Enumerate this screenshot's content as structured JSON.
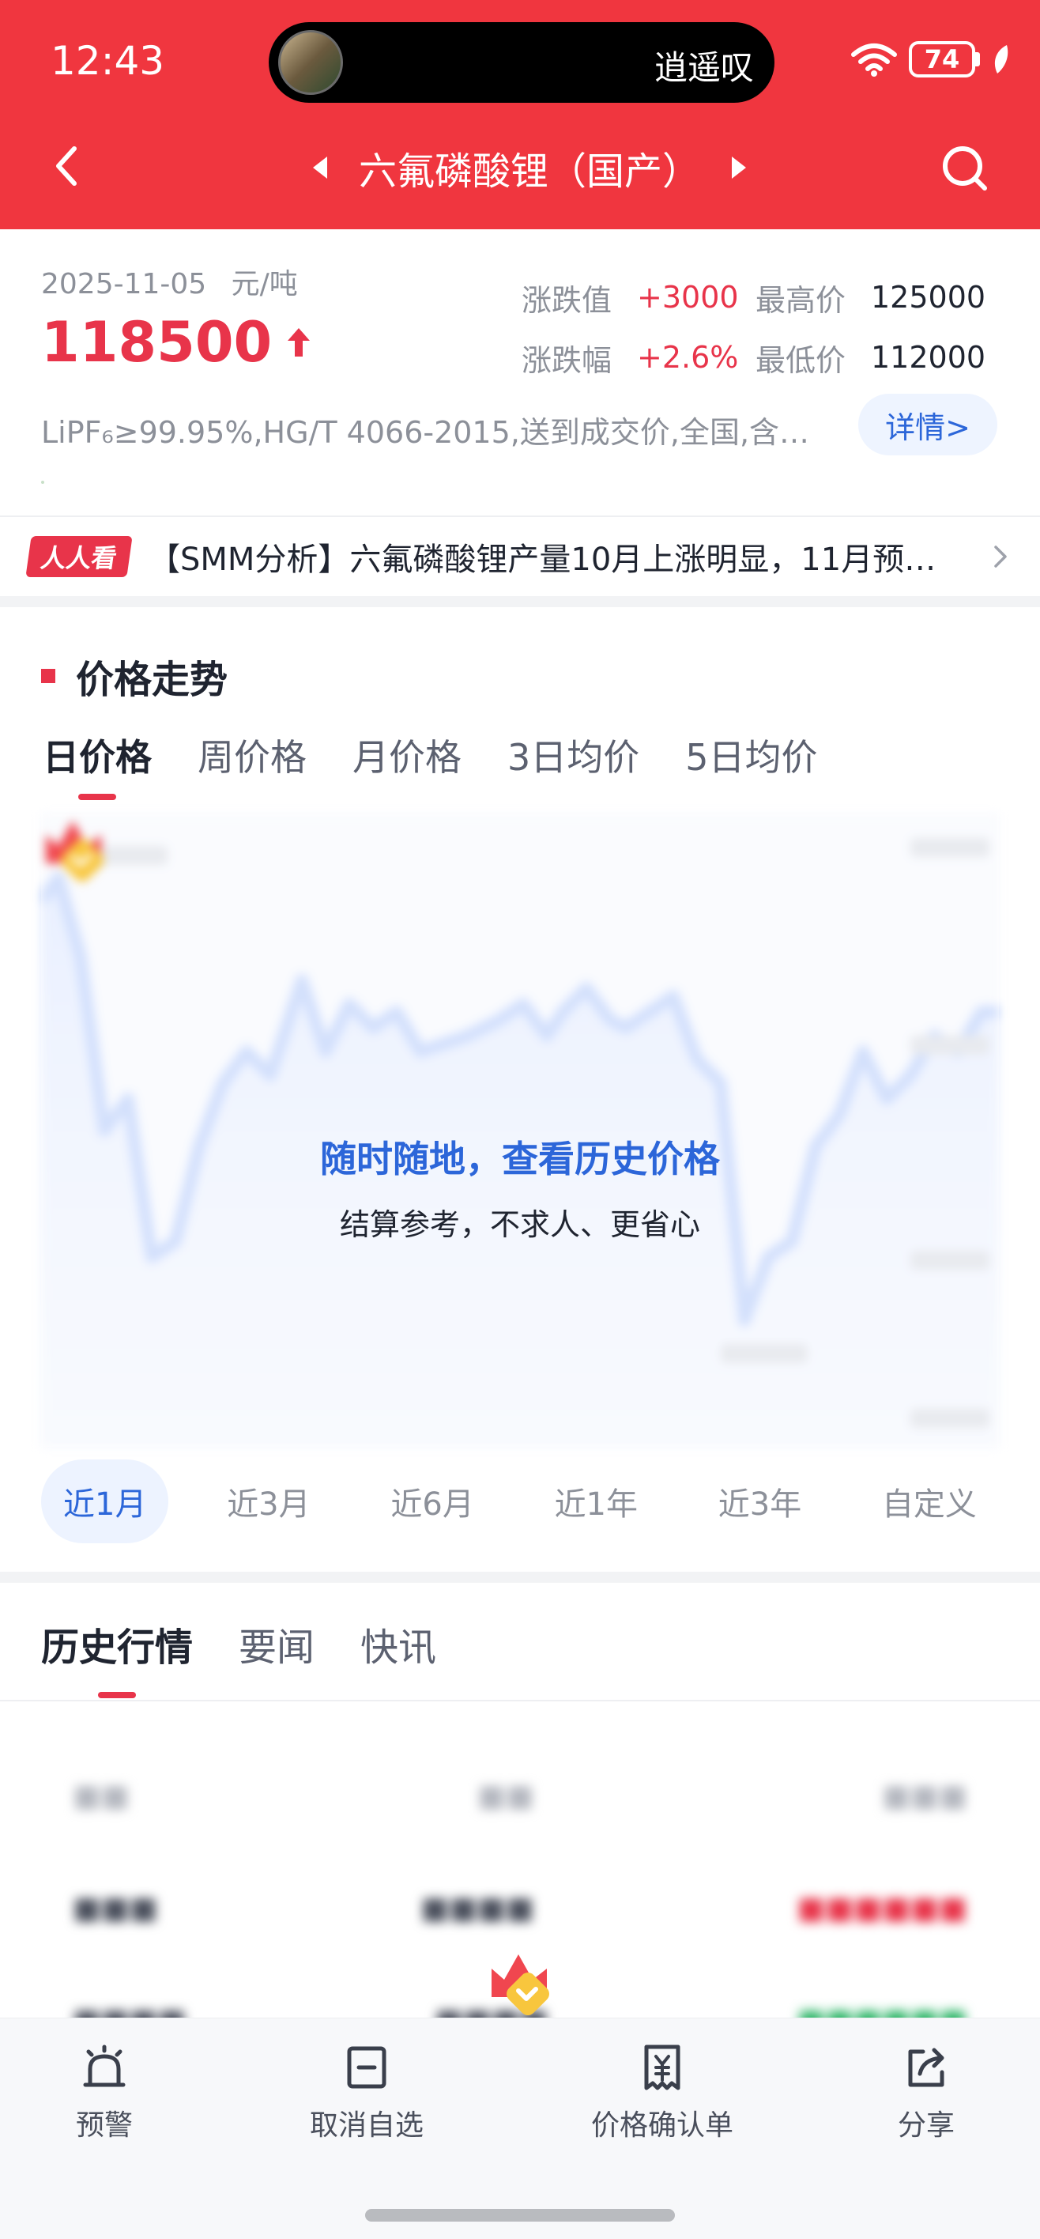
{
  "status_bar": {
    "time": "12:43",
    "island_text": "逍遥叹",
    "battery": "74"
  },
  "nav": {
    "title": "六氟磷酸锂（国产）"
  },
  "summary": {
    "date": "2025-11-05",
    "unit": "元/吨",
    "price": "118500",
    "change_label": "涨跌值",
    "change_value": "+3000",
    "high_label": "最高价",
    "high_value": "125000",
    "pct_label": "涨跌幅",
    "pct_value": "+2.6%",
    "low_label": "最低价",
    "low_value": "112000",
    "spec": "LiPF₆≥99.95%,HG/T 4066-2015,送到成交价,全国,含…",
    "detail_button": "详情>"
  },
  "ticker": {
    "badge": "人人看",
    "text": "【SMM分析】六氟磷酸锂产量10月上涨明显，11月预…"
  },
  "trend": {
    "title": "价格走势",
    "price_tabs": [
      "日价格",
      "周价格",
      "月价格",
      "3日均价",
      "5日均价"
    ],
    "active_price_tab": 0,
    "promo_title": "随时随地，查看历史价格",
    "promo_subtitle": "结算参考，不求人、更省心",
    "range_tabs": [
      "近1月",
      "近3月",
      "近6月",
      "近1年",
      "近3年",
      "自定义"
    ],
    "active_range_tab": 0
  },
  "history": {
    "tabs": [
      "历史行情",
      "要闻",
      "快讯"
    ],
    "active_tab": 0
  },
  "bottom_bar": {
    "items": [
      {
        "label": "预警",
        "icon": "alarm-icon"
      },
      {
        "label": "取消自选",
        "icon": "remove-watchlist-icon"
      },
      {
        "label": "价格确认单",
        "icon": "price-confirm-icon"
      },
      {
        "label": "分享",
        "icon": "share-icon"
      }
    ]
  },
  "colors": {
    "brand_red": "#f0363f",
    "price_red": "#e8344a",
    "link_blue": "#2c66d9"
  }
}
